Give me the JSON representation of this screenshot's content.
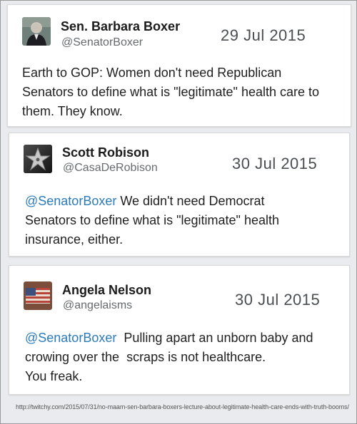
{
  "tweets": [
    {
      "name": "Sen. Barbara Boxer",
      "handle": "@SenatorBoxer",
      "date": "29 Jul 2015",
      "lines": [
        "Earth to GOP: Women don't need Republican",
        "Senators to define what is \"legitimate\" health care to",
        "them. They know."
      ]
    },
    {
      "name": "Scott Robison",
      "handle": "@CasaDeRobison",
      "date": "30 Jul 2015",
      "mention": "@SenatorBoxer",
      "lines": [
        " We didn't need  Democrat",
        "Senators to define what is \"legitimate\" health",
        "insurance, either."
      ]
    },
    {
      "name": "Angela Nelson",
      "handle": "@angelaisms",
      "date": "30 Jul 2015",
      "mention": "@SenatorBoxer",
      "lines": [
        "  Pulling apart an unborn baby and",
        "crowing over the  scraps is not healthcare.",
        "You freak."
      ]
    }
  ],
  "source_url": "http://twitchy.com/2015/07/31/no-maam-sen-barbara-boxers-lecture-about-legitimate-health-care-ends-with-truth-booms/",
  "colors": {
    "mention": "#2b7bb9",
    "background": "#e9ebee"
  },
  "icons": [
    "boxer-avatar-icon",
    "star-avatar-icon",
    "flag-avatar-icon"
  ]
}
